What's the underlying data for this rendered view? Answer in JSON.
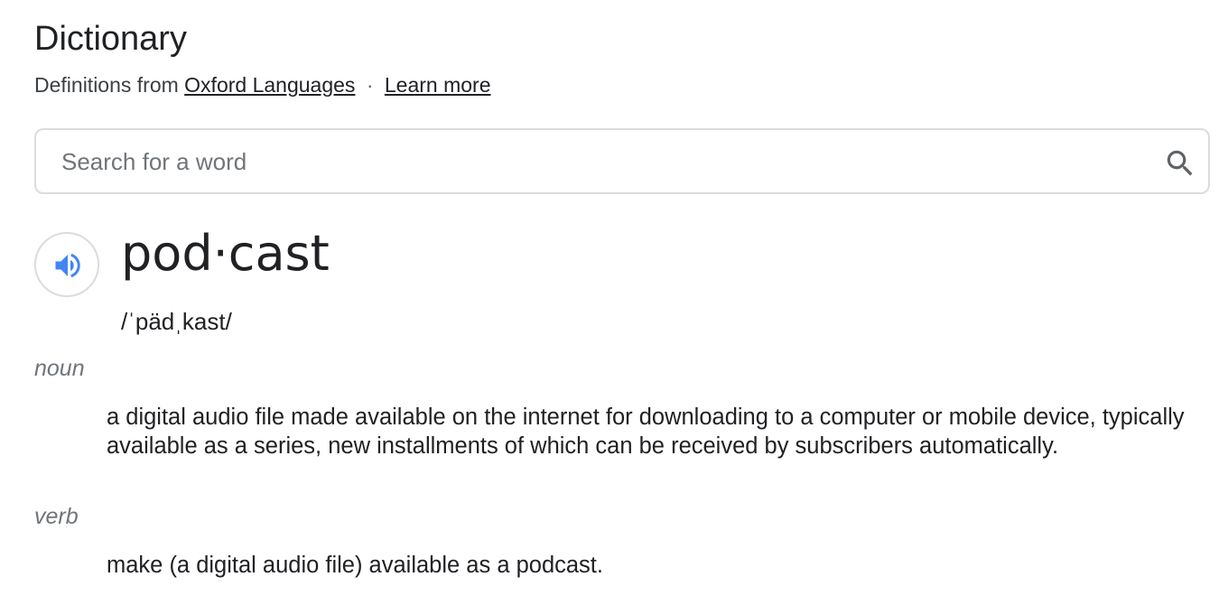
{
  "header": {
    "title": "Dictionary",
    "definitions_from": "Definitions from",
    "source_link": "Oxford Languages",
    "separator": "·",
    "learn_more": "Learn more"
  },
  "search": {
    "placeholder": "Search for a word",
    "value": "",
    "icon": "search-icon"
  },
  "entry": {
    "audio_icon": "speaker-icon",
    "word": "pod·cast",
    "phonetic": "/ˈpädˌkast/",
    "senses": [
      {
        "part_of_speech": "noun",
        "definition": "a digital audio file made available on the internet for downloading to a computer or mobile device, typically available as a series, new installments of which can be received by subscribers automatically."
      },
      {
        "part_of_speech": "verb",
        "definition": "make (a digital audio file) available as a podcast."
      }
    ]
  },
  "colors": {
    "accent": "#4285f4",
    "text": "#202124",
    "muted": "#70757a",
    "border": "#dadce0"
  }
}
